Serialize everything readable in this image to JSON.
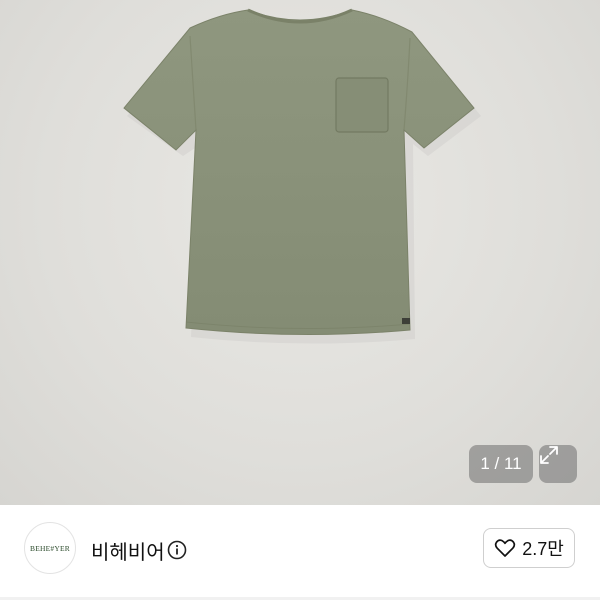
{
  "product_image": {
    "alt_subject": "olive green pocket t-shirt",
    "counter": "1 / 11",
    "expand_icon": "expand-icon"
  },
  "seller": {
    "avatar_text": "BEHE#YER",
    "name": "비헤비어",
    "info_icon": "info-icon"
  },
  "like": {
    "icon": "heart-icon",
    "count": "2.7만"
  },
  "colors": {
    "shirt": "#8a9279",
    "background": "#dfdeda",
    "overlay": "#6e6e6e"
  }
}
